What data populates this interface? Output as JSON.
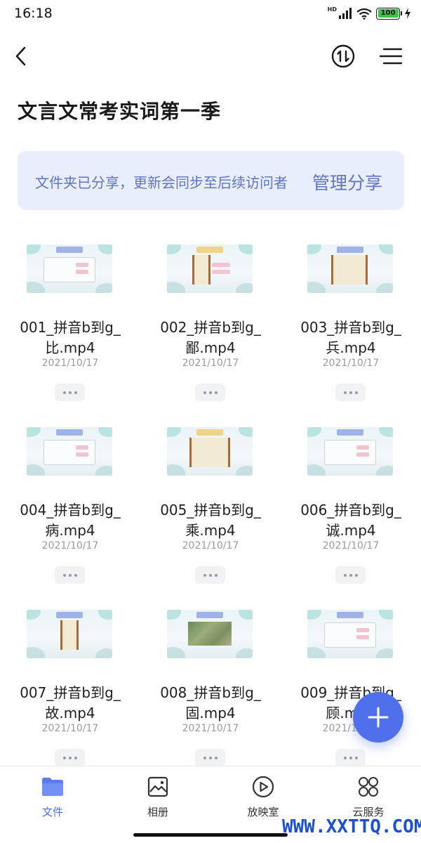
{
  "status_bar": {
    "time": "16:18",
    "network": "HD",
    "battery": "100"
  },
  "header": {
    "title": "文言文常考实词第一季"
  },
  "share_banner": {
    "text": "文件夹已分享，更新会同步至后续访问者",
    "action": "管理分享"
  },
  "files": [
    {
      "name": "001_拼音b到g_比.mp4",
      "date": "2021/10/17"
    },
    {
      "name": "002_拼音b到g_鄙.mp4",
      "date": "2021/10/17"
    },
    {
      "name": "003_拼音b到g_兵.mp4",
      "date": "2021/10/17"
    },
    {
      "name": "004_拼音b到g_病.mp4",
      "date": "2021/10/17"
    },
    {
      "name": "005_拼音b到g_乘.mp4",
      "date": "2021/10/17"
    },
    {
      "name": "006_拼音b到g_诚.mp4",
      "date": "2021/10/17"
    },
    {
      "name": "007_拼音b到g_故.mp4",
      "date": "2021/10/17"
    },
    {
      "name": "008_拼音b到g_固.mp4",
      "date": "2021/10/17"
    },
    {
      "name": "009_拼音b到g_顾.mp4",
      "date": "2021/10/17"
    }
  ],
  "bottom_nav": {
    "items": [
      {
        "label": "文件",
        "icon": "folder-icon"
      },
      {
        "label": "相册",
        "icon": "photo-album-icon"
      },
      {
        "label": "放映室",
        "icon": "play-icon"
      },
      {
        "label": "云服务",
        "icon": "grid-icon"
      }
    ],
    "active_index": 0
  },
  "watermark": "WWW.XXTTQ.COM",
  "colors": {
    "accent": "#4f70ea",
    "banner_bg": "#e8eefc",
    "banner_text": "#6074c4",
    "date_text": "#9a9a9a"
  }
}
